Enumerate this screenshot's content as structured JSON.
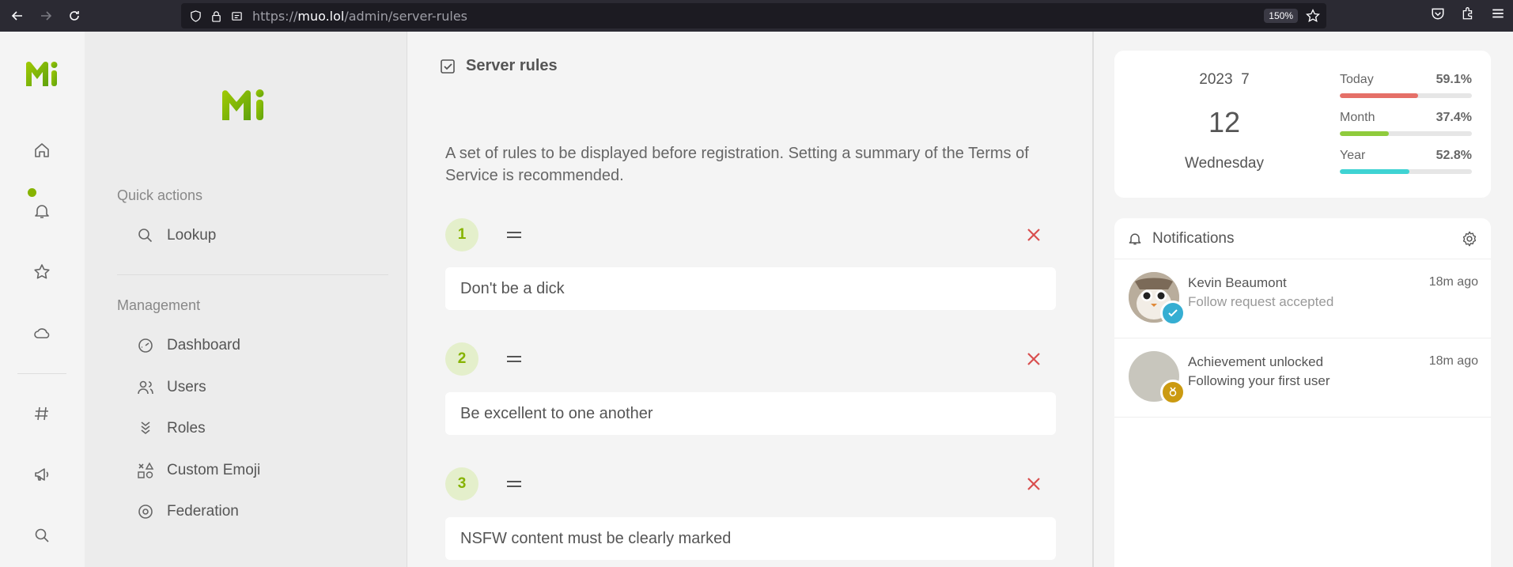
{
  "browser": {
    "url_host": "muo.lol",
    "url_path": "/admin/server-rules",
    "url_scheme": "https://",
    "zoom": "150%"
  },
  "rail": {
    "items": [
      "home-icon",
      "bell-icon",
      "star-icon",
      "cloud-icon",
      "hashtag-icon",
      "megaphone-icon",
      "search-icon"
    ],
    "notification_dot_color": "#86b300"
  },
  "sidebar": {
    "quick_actions_title": "Quick actions",
    "lookup_label": "Lookup",
    "management_title": "Management",
    "items": [
      {
        "label": "Dashboard",
        "icon": "gauge-icon"
      },
      {
        "label": "Users",
        "icon": "users-icon"
      },
      {
        "label": "Roles",
        "icon": "badges-icon"
      },
      {
        "label": "Custom Emoji",
        "icon": "icons-icon"
      },
      {
        "label": "Federation",
        "icon": "whirl-icon"
      }
    ]
  },
  "main": {
    "title": "Server rules",
    "description": "A set of rules to be displayed before registration. Setting a summary of the Terms of Service is recommended.",
    "rules": [
      {
        "num": "1",
        "text": "Don't be a dick"
      },
      {
        "num": "2",
        "text": "Be excellent to one another"
      },
      {
        "num": "3",
        "text": "NSFW content must be clearly marked"
      }
    ],
    "accent": "#86b300",
    "delete_color": "#d94f4f"
  },
  "calendar": {
    "year_month": "2023  7",
    "day": "12",
    "weekday": "Wednesday",
    "progress": [
      {
        "label": "Today",
        "pct_text": "59.1%",
        "value": 0.591,
        "color": "#e57068"
      },
      {
        "label": "Month",
        "pct_text": "37.4%",
        "value": 0.374,
        "color": "#8fcb3c"
      },
      {
        "label": "Year",
        "pct_text": "52.8%",
        "value": 0.528,
        "color": "#3fd3d3"
      }
    ]
  },
  "notifications": {
    "title": "Notifications",
    "items": [
      {
        "name": "Kevin Beaumont",
        "sub": "Follow request accepted",
        "time": "18m ago",
        "badge_color": "#36aed2"
      },
      {
        "name": "Achievement unlocked",
        "sub": "Following your first user",
        "time": "18m ago",
        "badge_color": "#cb9a11"
      }
    ]
  }
}
